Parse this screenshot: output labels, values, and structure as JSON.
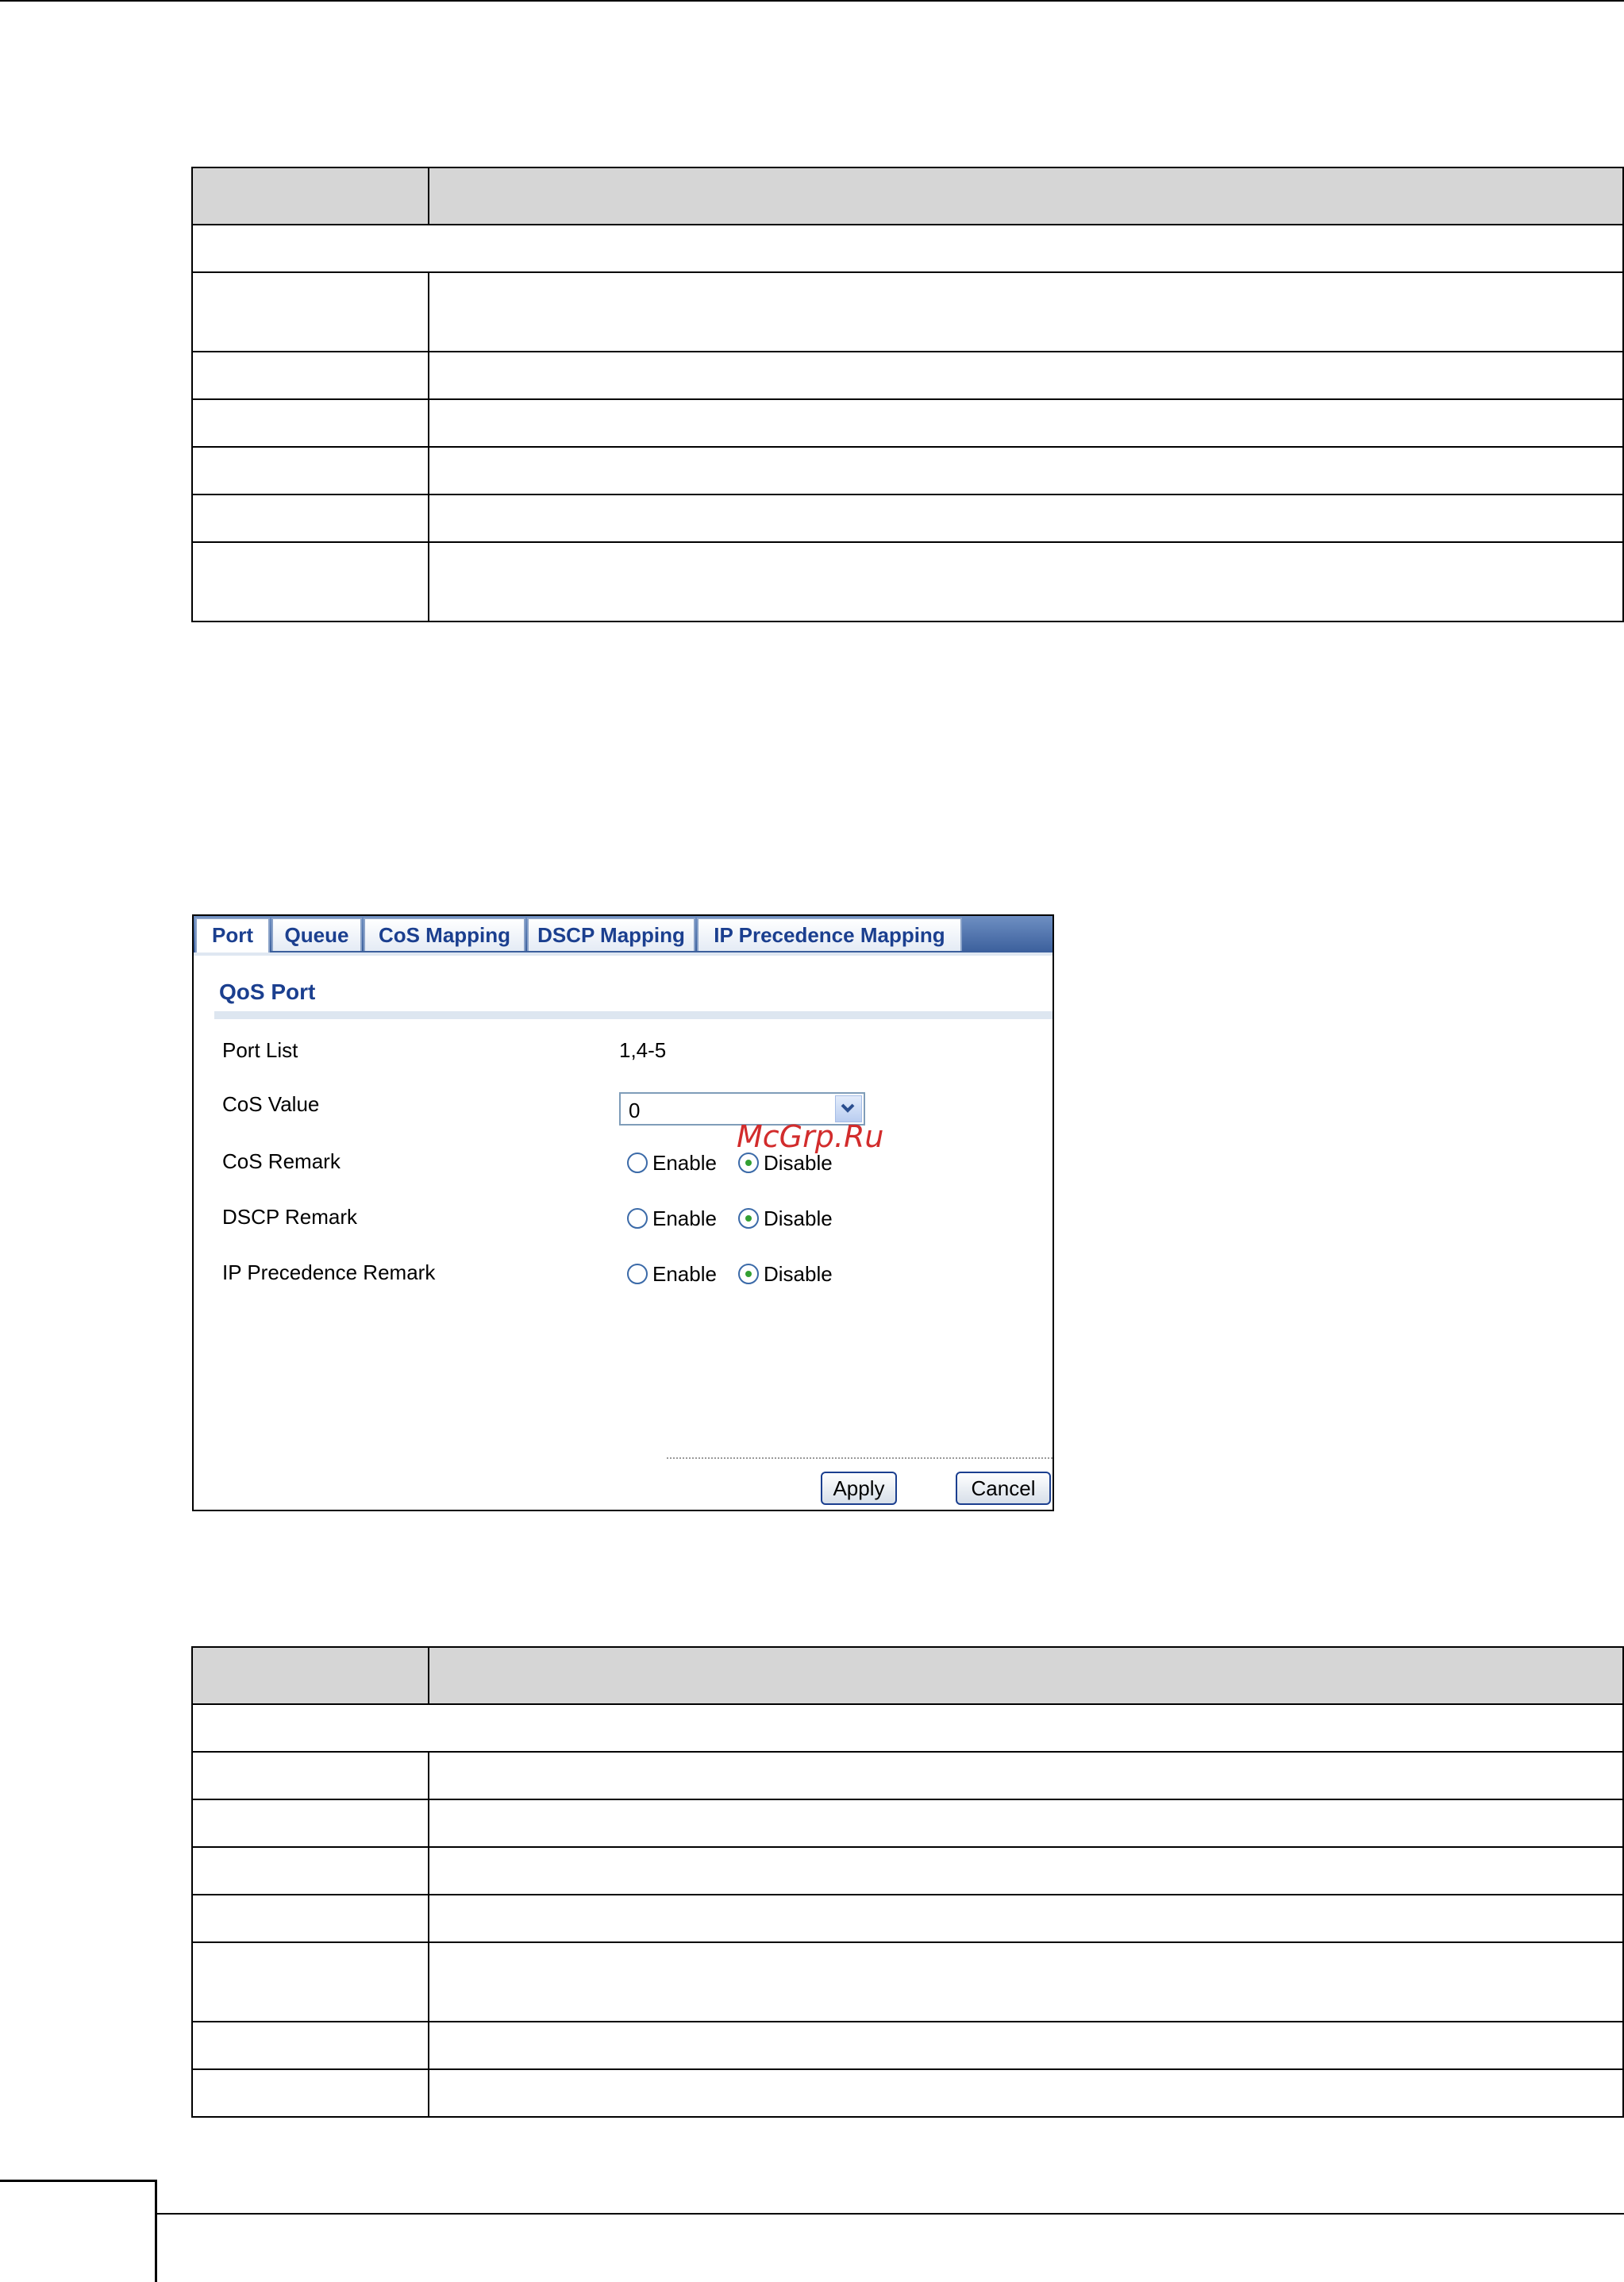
{
  "dialog": {
    "tabs": [
      {
        "label": "Port"
      },
      {
        "label": "Queue"
      },
      {
        "label": "CoS Mapping"
      },
      {
        "label": "DSCP Mapping"
      },
      {
        "label": "IP Precedence Mapping"
      }
    ],
    "active_tab": "Port",
    "section_title": "QoS Port",
    "port_list": {
      "label": "Port List",
      "value": "1,4-5"
    },
    "cos_value": {
      "label": "CoS Value",
      "selected": "0"
    },
    "cos_remark": {
      "label": "CoS Remark",
      "enable": "Enable",
      "disable": "Disable",
      "selected": "Disable"
    },
    "dscp_remark": {
      "label": "DSCP Remark",
      "enable": "Enable",
      "disable": "Disable",
      "selected": "Disable"
    },
    "ip_precedence_remark": {
      "label": "IP Precedence Remark",
      "enable": "Enable",
      "disable": "Disable",
      "selected": "Disable"
    },
    "buttons": {
      "apply": "Apply",
      "cancel": "Cancel"
    },
    "colors": {
      "tab_text": "#1b3f8f",
      "tabbar": "#3b5f9c",
      "radio_selected": "#33a033"
    }
  },
  "watermark": "McGrp.Ru"
}
